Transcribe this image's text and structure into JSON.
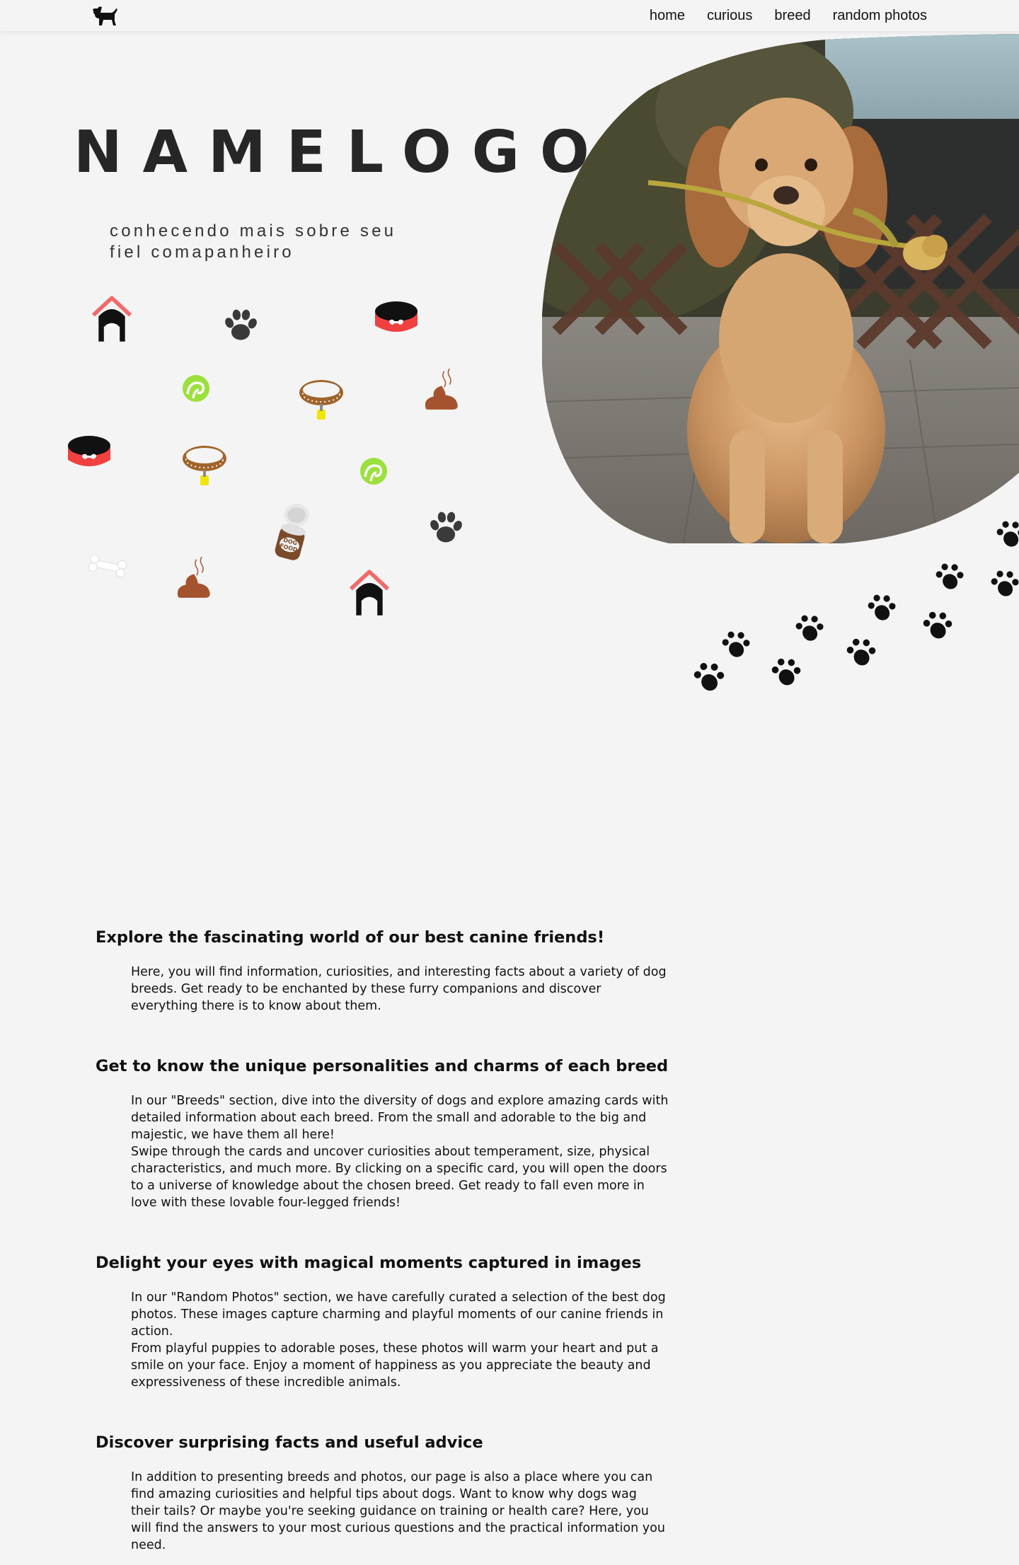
{
  "nav": {
    "items": [
      "home",
      "curious",
      "breed",
      "random photos"
    ]
  },
  "hero": {
    "brand": "NAMELOGO",
    "tagline": "conhecendo mais sobre seu fiel comapanheiro"
  },
  "icons": [
    "dog-house-icon",
    "paw-icon",
    "food-bowl-icon",
    "ball-icon",
    "collar-icon",
    "poop-icon",
    "bone-icon",
    "dog-food-can-icon"
  ],
  "colors": {
    "background": "#f4f4f4",
    "bowl_red": "#f04040",
    "collar_brown": "#a0642a",
    "ball_green": "#9be03c",
    "poop_brown": "#a5532f",
    "house_roof": "#f06a6a"
  },
  "sections": [
    {
      "heading": "Explore the fascinating world of our best canine friends!",
      "paragraphs": [
        "Here, you will find information, curiosities, and interesting facts about a variety of dog breeds. Get ready to be enchanted by these furry companions and discover everything there is to know about them."
      ]
    },
    {
      "heading": "Get to know the unique personalities and charms of each breed",
      "paragraphs": [
        "In our \"Breeds\" section, dive into the diversity of dogs and explore amazing cards with detailed information about each breed. From the small and adorable to the big and majestic, we have them all here!",
        "Swipe through the cards and uncover curiosities about temperament, size, physical characteristics, and much more. By clicking on a specific card, you will open the doors to a universe of knowledge about the chosen breed. Get ready to fall even more in love with these lovable four-legged friends!"
      ]
    },
    {
      "heading": "Delight your eyes with magical moments captured in images",
      "paragraphs": [
        "In our \"Random Photos\" section, we have carefully curated a selection of the best dog photos. These images capture charming and playful moments of our canine friends in action.",
        "From playful puppies to adorable poses, these photos will warm your heart and put a smile on your face. Enjoy a moment of happiness as you appreciate the beauty and expressiveness of these incredible animals."
      ]
    },
    {
      "heading": "Discover surprising facts and useful advice",
      "paragraphs": [
        "In addition to presenting breeds and photos, our page is also a place where you can find amazing curiosities and helpful tips about dogs. Want to know why dogs wag their tails? Or maybe you're seeking guidance on training or health care? Here, you will find the answers to your most curious questions and the practical information you need."
      ]
    }
  ]
}
